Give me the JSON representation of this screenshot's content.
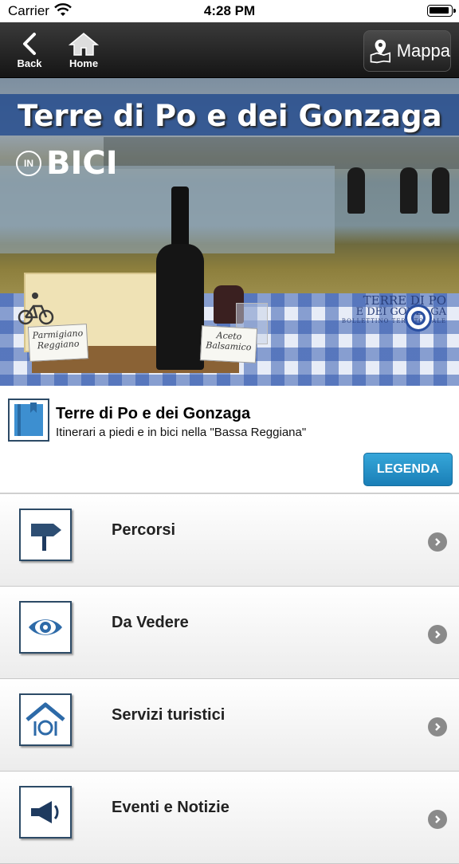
{
  "status": {
    "carrier": "Carrier",
    "time": "4:28 PM"
  },
  "nav": {
    "back_label": "Back",
    "home_label": "Home",
    "map_label": "Mappa"
  },
  "banner": {
    "title": "Terre di Po e dei Gonzaga",
    "badge": "IN",
    "badge_word": "BICI",
    "card1_line1": "Parmigiano",
    "card1_line2": "Reggiano",
    "card2_line1": "Aceto",
    "card2_line2": "Balsamico",
    "logo_line1": "TERRE DI PO",
    "logo_line2": "E DEI GONZAGA",
    "logo_line3": "BOLLETTINO TERRITORIALE"
  },
  "info": {
    "title": "Terre di Po e dei Gonzaga",
    "subtitle": "Itinerari a piedi e in bici nella \"Bassa Reggiana\"",
    "legend_button": "LEGENDA"
  },
  "menu": [
    {
      "label": "Percorsi",
      "icon": "signpost-icon"
    },
    {
      "label": "Da Vedere",
      "icon": "eye-icon"
    },
    {
      "label": "Servizi turistici",
      "icon": "house-restaurant-icon"
    },
    {
      "label": "Eventi e Notizie",
      "icon": "megaphone-icon"
    }
  ],
  "colors": {
    "accent": "#1f8ac4",
    "icon_border": "#2c4a66",
    "nav_bg": "#1f1f1f"
  }
}
